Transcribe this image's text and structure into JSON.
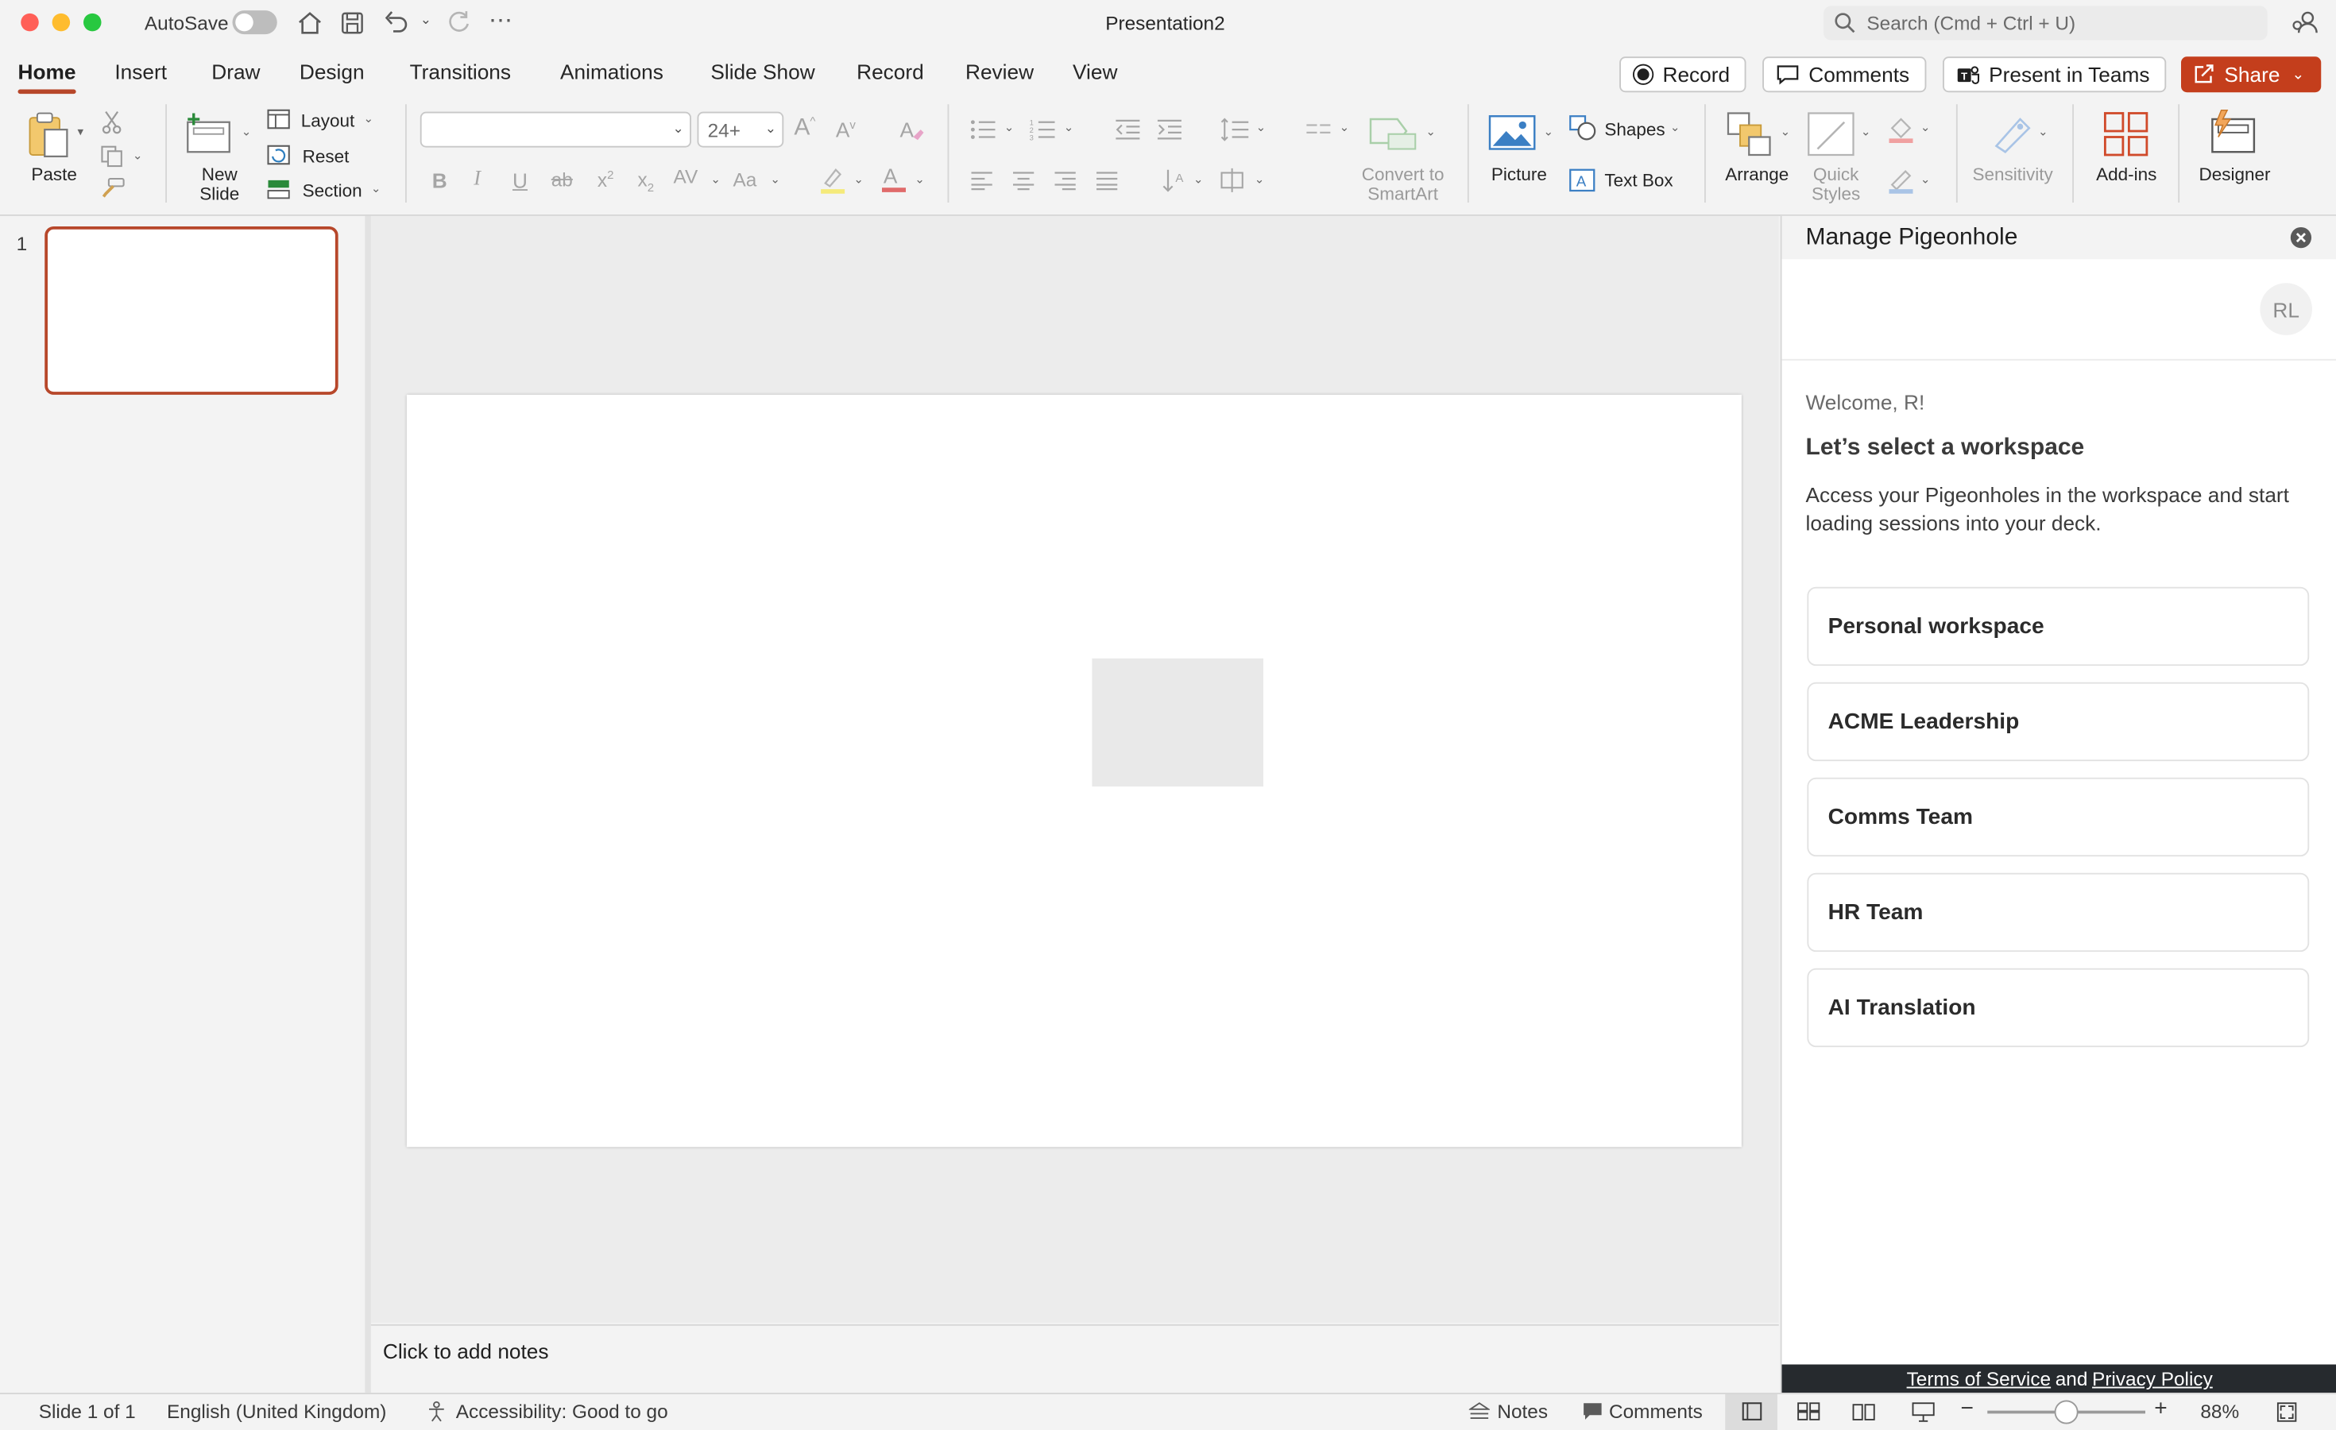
{
  "window": {
    "title": "Presentation2",
    "autosave_label": "AutoSave",
    "search_placeholder": "Search (Cmd + Ctrl + U)"
  },
  "tabs": [
    "Home",
    "Insert",
    "Draw",
    "Design",
    "Transitions",
    "Animations",
    "Slide Show",
    "Record",
    "Review",
    "View"
  ],
  "header_buttons": {
    "record": "Record",
    "comments": "Comments",
    "present_in_teams": "Present in Teams",
    "share": "Share"
  },
  "ribbon": {
    "paste": "Paste",
    "new_slide_line1": "New",
    "new_slide_line2": "Slide",
    "layout": "Layout",
    "reset": "Reset",
    "section": "Section",
    "font_name": "",
    "font_size": "24+",
    "convert_smartart_line1": "Convert to",
    "convert_smartart_line2": "SmartArt",
    "picture": "Picture",
    "shapes": "Shapes",
    "text_box": "Text Box",
    "arrange": "Arrange",
    "quick_styles_line1": "Quick",
    "quick_styles_line2": "Styles",
    "sensitivity": "Sensitivity",
    "add_ins": "Add-ins",
    "designer": "Designer"
  },
  "thumbnails": [
    {
      "number": "1"
    }
  ],
  "notes_placeholder": "Click to add notes",
  "pane": {
    "title": "Manage Pigeonhole",
    "avatar_initials": "RL",
    "welcome": "Welcome, R!",
    "heading": "Let’s select a workspace",
    "description": "Access your Pigeonholes in the workspace and start loading sessions into your deck.",
    "workspaces": [
      "Personal workspace",
      "ACME Leadership",
      "Comms Team",
      "HR Team",
      "AI Translation"
    ],
    "footer_terms": "Terms of Service",
    "footer_and": "and",
    "footer_privacy": "Privacy Policy"
  },
  "statusbar": {
    "slide_info": "Slide 1 of 1",
    "language": "English (United Kingdom)",
    "accessibility": "Accessibility: Good to go",
    "notes": "Notes",
    "comments": "Comments",
    "zoom": "88%",
    "zoom_level": 0.5
  },
  "colors": {
    "accent": "#b7472a",
    "share_bg": "#c43e1c"
  }
}
